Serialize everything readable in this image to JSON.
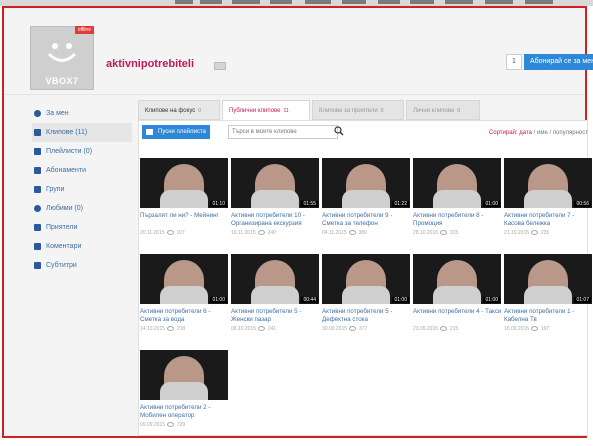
{
  "header": {
    "avatar_brand": "VBOX7",
    "avatar_badge": "offline",
    "username": "aktivnipotrebiteli",
    "subscriber_count": "1",
    "subscribe_label": "Абонирай се за мен"
  },
  "sidebar": {
    "items": [
      {
        "label": "За мен",
        "icon": "user-icon"
      },
      {
        "label": "Клипове (11)",
        "icon": "video-icon"
      },
      {
        "label": "Плейлисти (0)",
        "icon": "playlist-icon"
      },
      {
        "label": "Абонаменти",
        "icon": "subscriptions-icon"
      },
      {
        "label": "Групи",
        "icon": "groups-icon"
      },
      {
        "label": "Любими (0)",
        "icon": "heart-icon"
      },
      {
        "label": "Приятели",
        "icon": "friends-icon"
      },
      {
        "label": "Коментари",
        "icon": "comments-icon"
      },
      {
        "label": "Субтитри",
        "icon": "subtitles-icon"
      }
    ]
  },
  "tabs": [
    {
      "label": "Клипове на фокус",
      "count": "0"
    },
    {
      "label": "Публични клипове",
      "count": "11"
    },
    {
      "label": "Клипове за приятели",
      "count": "0"
    },
    {
      "label": "Лични клипове",
      "count": "0"
    }
  ],
  "tools": {
    "playlist_button": "Пусни плейлиста",
    "search_placeholder": "Търси в моите клипове",
    "sort_label": "Сортирай:",
    "sort_current": "дата",
    "sort_rest": " / име / популярност"
  },
  "videos": [
    {
      "title": "Пързалят ли ни? - Мейнинг",
      "date": "20.11.2015",
      "views": "107",
      "duration": "01:10"
    },
    {
      "title": "Активни потребители 10 - Организирана екскурзия",
      "date": "10.11.2015",
      "views": "240",
      "duration": "01:55"
    },
    {
      "title": "Активни потребители 9 - Сметка за телефон",
      "date": "04.11.2015",
      "views": "380",
      "duration": "01:22"
    },
    {
      "title": "Активни потребители 8 - Промоция",
      "date": "28.10.2015",
      "views": "315",
      "duration": "01:00"
    },
    {
      "title": "Активни потребители 7 - Касова бележка",
      "date": "21.10.2015",
      "views": "235",
      "duration": "00:56"
    },
    {
      "title": "Активни потребители 6 - Сметка за вода",
      "date": "14.10.2015",
      "views": "218",
      "duration": "01:00"
    },
    {
      "title": "Активни потребители 5 - Женски пазар",
      "date": "08.10.2015",
      "views": "241",
      "duration": "00:44"
    },
    {
      "title": "Активни потребители 5 - Дефектна стока",
      "date": "30.09.2015",
      "views": "377",
      "duration": "01:00"
    },
    {
      "title": "Активни потребители 4 - Такси",
      "date": "23.09.2015",
      "views": "215",
      "duration": "01:00"
    },
    {
      "title": "Активни потребители 1 - Кабелна Тв",
      "date": "16.09.2015",
      "views": "197",
      "duration": "01:07"
    },
    {
      "title": "Активни потребители 2 - Мобилен оператор",
      "date": "09.09.2015",
      "views": "729",
      "duration": ""
    }
  ],
  "colors": {
    "accent": "#2e88d8",
    "username": "#c2185b",
    "frame": "#d21f1f",
    "link": "#3d6fa8"
  }
}
